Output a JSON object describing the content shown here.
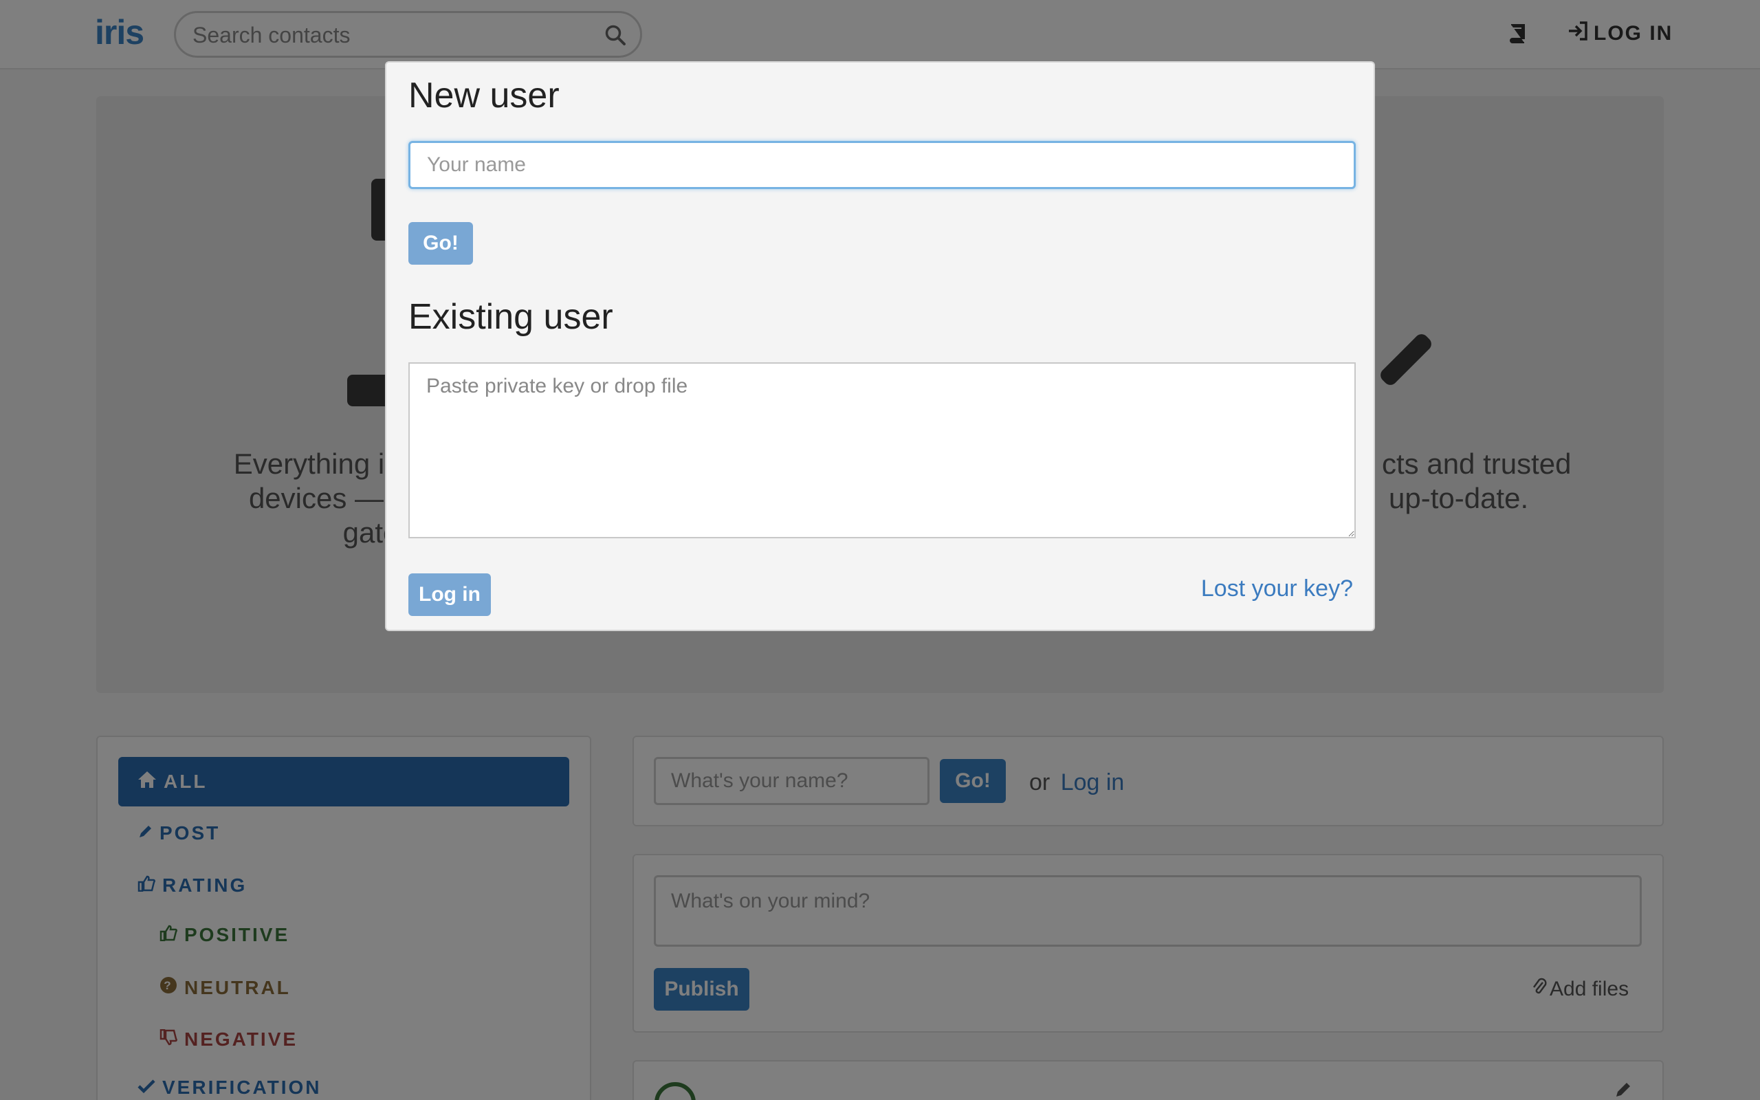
{
  "navbar": {
    "brand": "iris",
    "search_placeholder": "Search contacts",
    "login_label": "LOG IN"
  },
  "jumbotron": {
    "text_left_line1": "Everything is",
    "text_left_line2": "devices —",
    "text_left_line3": "gatek",
    "text_right_line1": "cts and trusted",
    "text_right_line2": "up-to-date."
  },
  "filters": {
    "all": "ALL",
    "post": "POST",
    "rating": "RATING",
    "positive": "POSITIVE",
    "neutral": "NEUTRAL",
    "negative": "NEGATIVE",
    "verification": "VERIFICATION"
  },
  "feed": {
    "name_placeholder": "What's your name?",
    "go_label": "Go!",
    "or_text": "or",
    "login_link": "Log in",
    "post_placeholder": "What's on your mind?",
    "publish_label": "Publish",
    "add_files_label": "Add files"
  },
  "modal": {
    "new_user_heading": "New user",
    "name_placeholder": "Your name",
    "go_label": "Go!",
    "existing_user_heading": "Existing user",
    "key_placeholder": "Paste private key or drop file",
    "login_label": "Log in",
    "lost_key_link": "Lost your key?"
  },
  "colors": {
    "brand": "#3b82c4",
    "positive": "#3c763d",
    "neutral": "#8a6d3b",
    "negative": "#a94442",
    "modal_button": "#79a7d4"
  }
}
